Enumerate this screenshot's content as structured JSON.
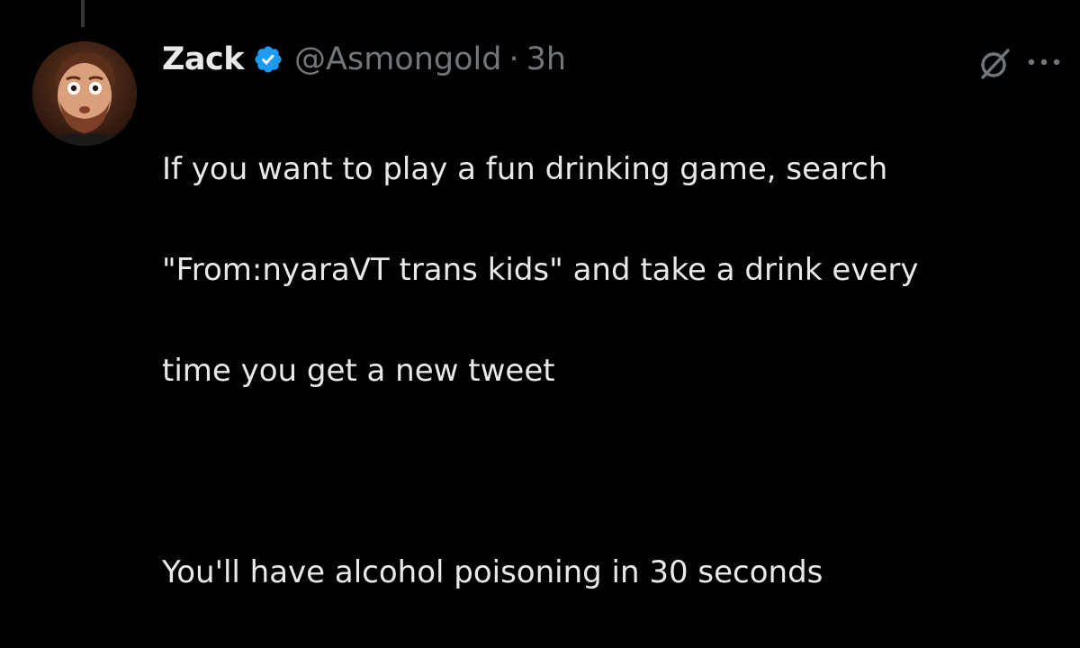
{
  "tweet": {
    "author": {
      "display_name": "Zack",
      "handle": "@Asmongold",
      "verified": true,
      "verified_color": "#1d9bf0"
    },
    "separator": "·",
    "time": "3h",
    "text_lines": [
      "If you want to play a fun drinking game, search",
      "\"From:nyaraVT trans kids\" and take a drink every",
      "time you get a new tweet",
      "",
      "You'll have alcohol poisoning in 30 seconds"
    ]
  },
  "icons": {
    "verified": "verified-badge-icon",
    "grok": "grok-icon",
    "more": "more-options-icon"
  },
  "colors": {
    "background": "#000000",
    "primary_text": "#e7e9ea",
    "secondary_text": "#71767b"
  }
}
